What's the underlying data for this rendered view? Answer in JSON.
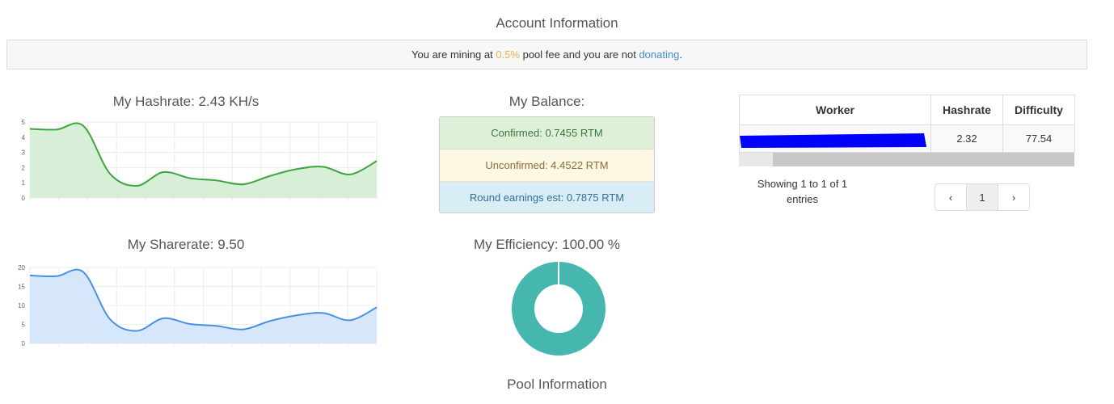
{
  "account_title": "Account Information",
  "fee_notice": {
    "prefix": "You are mining at ",
    "fee": "0.5%",
    "middle": " pool fee and you are not ",
    "link": "donating",
    "suffix": "."
  },
  "colors": {
    "hashrate_line": "#3ea53e",
    "hashrate_fill": "#d7efd6",
    "sharerate_line": "#4a90e2",
    "sharerate_fill": "#d6e6fb",
    "efficiency": "#45b7af",
    "fee_highlight": "#f0ad4e",
    "redaction": "#0000ff"
  },
  "hashrate": {
    "title": "My Hashrate: 2.43 KH/s",
    "chart_data": {
      "type": "area",
      "ylim": [
        0,
        5
      ],
      "yticks": [
        "0",
        "1",
        "2",
        "3",
        "4",
        "5"
      ],
      "values": [
        4.55,
        4.5,
        4.75,
        1.6,
        0.8,
        1.7,
        1.3,
        1.15,
        0.9,
        1.45,
        1.9,
        2.05,
        1.55,
        2.43
      ]
    }
  },
  "sharerate": {
    "title": "My Sharerate: 9.50",
    "chart_data": {
      "type": "area",
      "ylim": [
        0,
        20
      ],
      "yticks": [
        "0",
        "5",
        "10",
        "15",
        "20"
      ],
      "values": [
        17.9,
        17.7,
        18.8,
        6.4,
        3.3,
        6.6,
        5.1,
        4.6,
        3.7,
        5.9,
        7.4,
        8.0,
        6.1,
        9.5
      ]
    }
  },
  "balance": {
    "title": "My Balance:",
    "confirmed": "Confirmed: 0.7455 RTM",
    "unconfirmed": "Unconfirmed: 4.4522 RTM",
    "round": "Round earnings est: 0.7875 RTM"
  },
  "efficiency": {
    "title": "My Efficiency: 100.00 %",
    "chart_data": {
      "type": "pie",
      "values": [
        100
      ]
    }
  },
  "workers": {
    "headers": [
      "Worker",
      "Hashrate",
      "Difficulty"
    ],
    "rows": [
      {
        "hashrate": "2.32",
        "difficulty": "77.54"
      }
    ],
    "info": "Showing 1 to 1 of 1 entries",
    "pagination": {
      "prev": "‹",
      "page": "1",
      "next": "›"
    }
  },
  "pool_title": "Pool Information"
}
